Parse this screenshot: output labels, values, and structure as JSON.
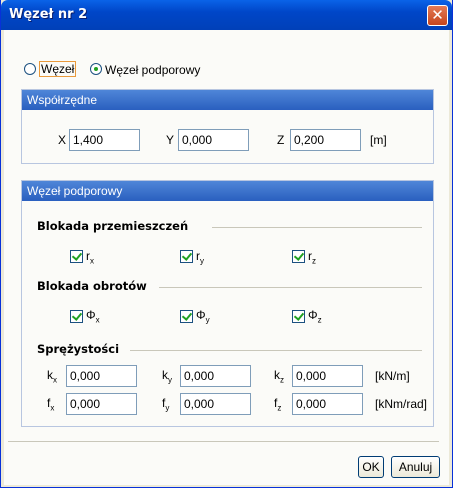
{
  "window": {
    "title": "Węzeł nr 2",
    "close_glyph": "✕"
  },
  "node_type": {
    "options": [
      "Węzeł",
      "Węzeł podporowy"
    ],
    "selected": "Węzeł podporowy"
  },
  "coords": {
    "header": "Współrzędne",
    "x_label": "X",
    "x_value": "1,400",
    "y_label": "Y",
    "y_value": "0,000",
    "z_label": "Z",
    "z_value": "0,200",
    "unit": "[m]"
  },
  "support": {
    "header": "Węzeł podporowy",
    "displacement": {
      "title": "Blokada przemieszczeń",
      "items": [
        {
          "base": "r",
          "sub": "x",
          "checked": true
        },
        {
          "base": "r",
          "sub": "y",
          "checked": true
        },
        {
          "base": "r",
          "sub": "z",
          "checked": true
        }
      ]
    },
    "rotation": {
      "title": "Blokada obrotów",
      "items": [
        {
          "base": "Φ",
          "sub": "x",
          "checked": true
        },
        {
          "base": "Φ",
          "sub": "y",
          "checked": true
        },
        {
          "base": "Φ",
          "sub": "z",
          "checked": true
        }
      ]
    },
    "elasticity": {
      "title": "Sprężystości",
      "k": {
        "base": "k",
        "x": "0,000",
        "y": "0,000",
        "z": "0,000",
        "unit": "[kN/m]"
      },
      "f": {
        "base": "f",
        "x": "0,000",
        "y": "0,000",
        "z": "0,000",
        "unit": "[kNm/rad]"
      }
    }
  },
  "buttons": {
    "ok": "OK",
    "cancel": "Anuluj"
  }
}
